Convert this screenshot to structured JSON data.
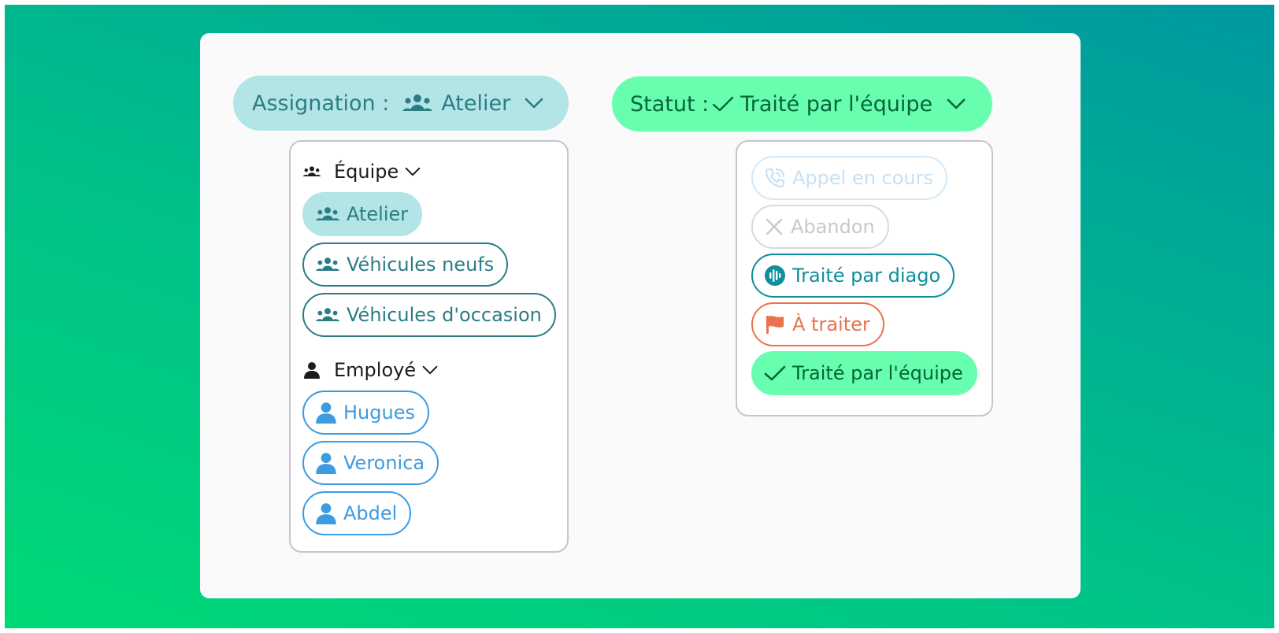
{
  "assignment": {
    "label": "Assignation :",
    "selected": "Atelier",
    "team_group": {
      "title": "Équipe",
      "items": [
        "Atelier",
        "Véhicules neufs",
        "Véhicules d'occasion"
      ],
      "selected_index": 0
    },
    "employee_group": {
      "title": "Employé",
      "items": [
        "Hugues",
        "Veronica",
        "Abdel"
      ]
    }
  },
  "status": {
    "label": "Statut :",
    "selected": "Traité par l'équipe",
    "options": [
      {
        "label": "Appel en cours",
        "icon": "phone-call-icon",
        "color": "#c6e1f3"
      },
      {
        "label": "Abandon",
        "icon": "close-icon",
        "color": "#c9c9c9"
      },
      {
        "label": "Traité par diago",
        "icon": "audio-wave-icon",
        "color": "#0f8e9c"
      },
      {
        "label": "À traiter",
        "icon": "flag-icon",
        "color": "#e8734c"
      },
      {
        "label": "Traité par l'équipe",
        "icon": "check-icon",
        "color": "#07653a"
      }
    ]
  },
  "colors": {
    "assign_bg": "#b3e5e6",
    "assign_text": "#2a7d85",
    "status_bg": "#68feb0",
    "status_text": "#07653a",
    "employee": "#3d9be0"
  }
}
